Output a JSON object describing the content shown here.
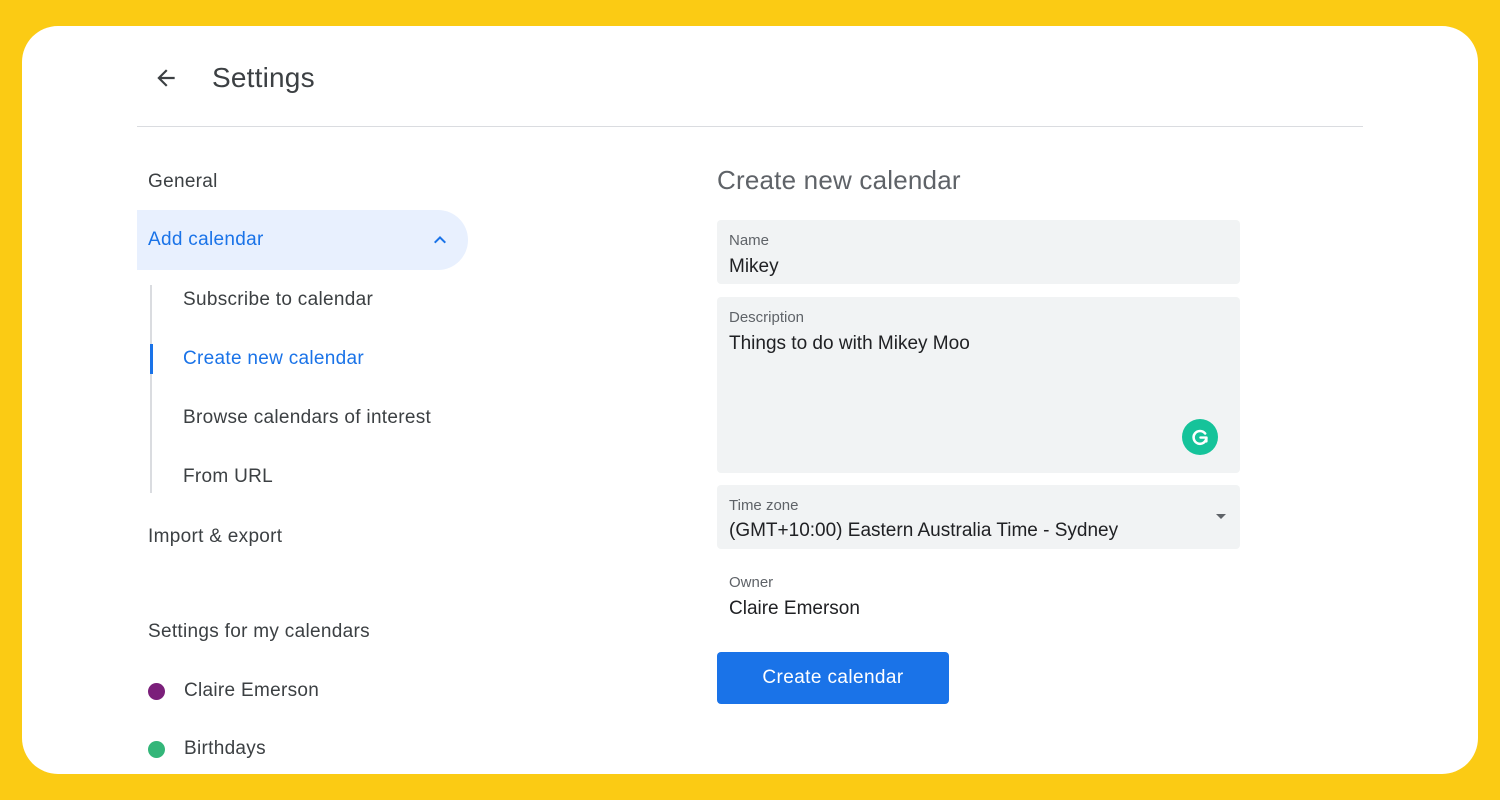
{
  "header": {
    "title": "Settings",
    "back_icon": "arrow-back-icon"
  },
  "sidebar": {
    "general": "General",
    "add_calendar": {
      "label": "Add calendar",
      "expanded": true,
      "icon": "chevron-up-icon"
    },
    "sub_items": [
      {
        "label": "Subscribe to calendar",
        "active": false
      },
      {
        "label": "Create new calendar",
        "active": true
      },
      {
        "label": "Browse calendars of interest",
        "active": false
      },
      {
        "label": "From URL",
        "active": false
      }
    ],
    "import_export": "Import & export",
    "my_calendars_heading": "Settings for my calendars",
    "my_calendars": [
      {
        "label": "Claire Emerson",
        "color": "#7B1F7A"
      },
      {
        "label": "Birthdays",
        "color": "#33B679"
      }
    ]
  },
  "form": {
    "title": "Create new calendar",
    "name": {
      "label": "Name",
      "value": "Mikey"
    },
    "description": {
      "label": "Description",
      "value": "Things to do with Mikey Moo"
    },
    "grammarly_icon": "grammarly-icon",
    "time_zone": {
      "label": "Time zone",
      "value": "(GMT+10:00) Eastern Australia Time - Sydney"
    },
    "owner": {
      "label": "Owner",
      "value": "Claire Emerson"
    },
    "submit_label": "Create calendar"
  },
  "colors": {
    "frame": "#FBCB14",
    "accent": "#1A73E8",
    "active_nav_bg": "#E8F0FE",
    "field_bg": "#F1F3F4",
    "grammarly": "#15C39A"
  }
}
